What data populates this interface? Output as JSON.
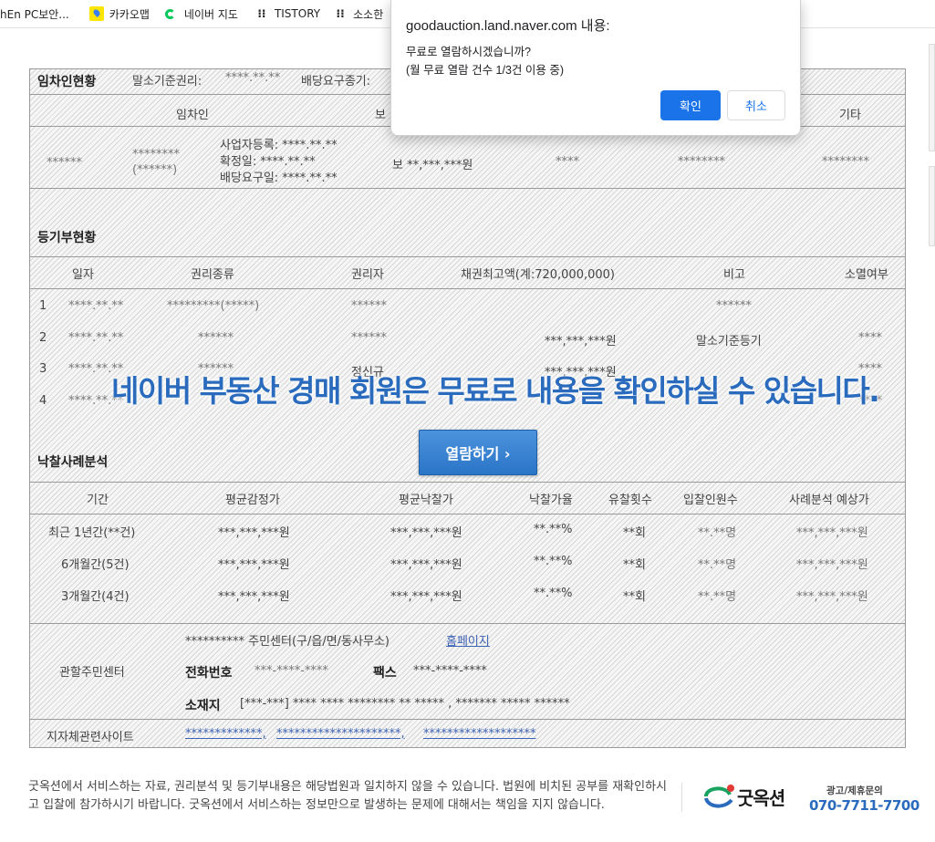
{
  "bookmarks": [
    {
      "label": "hEn PC보안...",
      "icon": "page-icon"
    },
    {
      "label": "카카오맵",
      "icon": "kakaomap-icon"
    },
    {
      "label": "네이버 지도",
      "icon": "naver-map-icon"
    },
    {
      "label": "TISTORY",
      "icon": "tistory-icon"
    },
    {
      "label": "소소한",
      "icon": "tistory-icon"
    }
  ],
  "report": {
    "tenant": {
      "heading": "임차인현황",
      "sub1": "말소기준권리:",
      "sub1_val": "****.**.**",
      "sub2": "배당요구종기:",
      "cols": [
        "임차인",
        "보",
        "기타"
      ],
      "row": {
        "name": "******",
        "id": "********",
        "id2": "(******)",
        "l1": "사업자등록: ****.**.**",
        "l2": "확정일: ****.**.**",
        "l3": "배당요구일: ****.**.**",
        "deposit": "보 **,***,***원",
        "c4": "****",
        "c5": "********",
        "c6": "********"
      }
    },
    "registry": {
      "heading": "등기부현황",
      "cols": [
        "일자",
        "권리종류",
        "권리자",
        "채권최고액(계:720,000,000)",
        "비고",
        "소멸여부"
      ],
      "rows": [
        {
          "no": "1",
          "date": "****.**.**",
          "type": "*********(*****)",
          "holder": "******",
          "amount": "",
          "note": "******",
          "ext": ""
        },
        {
          "no": "2",
          "date": "****.**.**",
          "type": "******",
          "holder": "******",
          "amount": "***,***,***원",
          "note": "말소기준등기",
          "ext": "****"
        },
        {
          "no": "3",
          "date": "****.**.**",
          "type": "******",
          "holder": "정신규",
          "amount": "***,***,***원",
          "note": "",
          "ext": "****"
        },
        {
          "no": "4",
          "date": "****.**.**",
          "type": "",
          "holder": "",
          "amount": "",
          "note": "",
          "ext": "****"
        }
      ]
    },
    "overlay": {
      "message": "네이버 부동산 경매 회원은 무료로 내용을 확인하실 수 있습니다.",
      "button": "열람하기 ›"
    },
    "analysis": {
      "heading": "낙찰사례분석",
      "cols": [
        "기간",
        "평균감정가",
        "평균낙찰가",
        "낙찰가율",
        "유찰횟수",
        "입찰인원수",
        "사례분석 예상가"
      ],
      "rows": [
        {
          "period": "최근 1년간(**건)",
          "appr": "***,***,***원",
          "bid": "***,***,***원",
          "rate": "**.**%",
          "fail": "**회",
          "people": "**.**명",
          "est": "***,***,***원"
        },
        {
          "period": "6개월간(5건)",
          "appr": "***,***,***원",
          "bid": "***,***,***원",
          "rate": "**.**%",
          "fail": "**회",
          "people": "**.**명",
          "est": "***,***,***원"
        },
        {
          "period": "3개월간(4건)",
          "appr": "***,***,***원",
          "bid": "***,***,***원",
          "rate": "**.**%",
          "fail": "**회",
          "people": "**.**명",
          "est": "***,***,***원"
        }
      ]
    },
    "center": {
      "label": "관할주민센터",
      "name": "********** 주민센터(구/읍/면/동사무소)",
      "homepage": "홈페이지",
      "phone_label": "전화번호",
      "phone": "***-****-****",
      "fax_label": "팩스",
      "fax": "***-****-****",
      "addr_label": "소재지",
      "addr": "[***-***] **** **** ******** ** ***** , ******* ***** ******"
    },
    "sites": {
      "label": "지자체관련사이트",
      "links": [
        "*************,",
        "*********************,",
        "*******************"
      ]
    }
  },
  "dialog": {
    "title": "goodauction.land.naver.com 내용:",
    "message1": "무료로 열람하시겠습니까?",
    "message2": "(월 무료 열람 건수 1/3건 이용 중)",
    "ok": "확인",
    "cancel": "취소"
  },
  "footer": {
    "disclaimer": "굿옥션에서 서비스하는 자료, 권리분석 및 등기부내용은 해당법원과 일치하지 않을 수 있습니다. 법원에 비치된 공부를 재확인하시고 입찰에 참가하시기 바랍니다. 굿옥션에서 서비스하는 정보만으로 발생하는 문제에 대해서는 책임을 지지 않습니다.",
    "logo": "굿옥션",
    "contact_label": "광고/제휴문의",
    "contact_phone": "070-7711-7700"
  },
  "colors": {
    "accent": "#1a73e8",
    "brand_blue": "#2a6bbd",
    "logo_green": "#1aa260",
    "logo_red": "#e53935"
  }
}
